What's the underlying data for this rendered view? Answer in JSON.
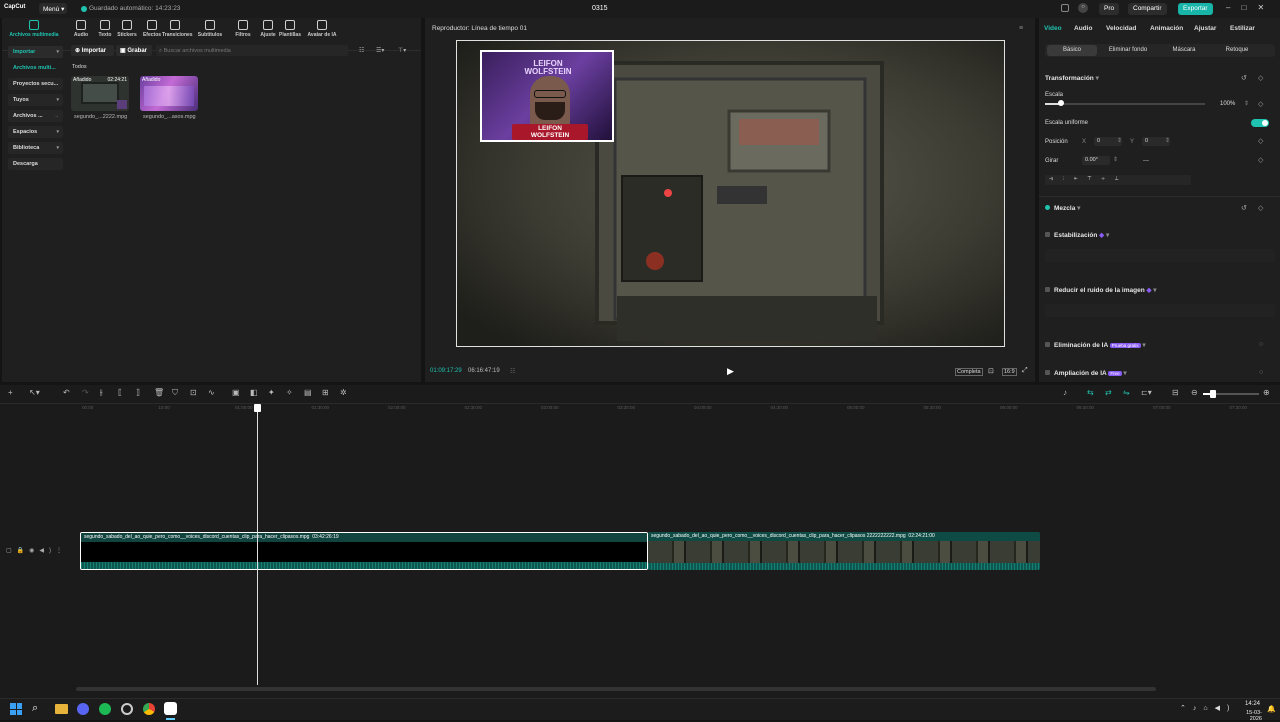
{
  "titlebar": {
    "app_logo": "CapCut",
    "menu_label": "Menú",
    "autosave_text": "Guardado automático: 14:23:23",
    "project_name": "0315",
    "pro_label": "Pro",
    "share_label": "Compartir",
    "export_label": "Exportar"
  },
  "toolbar": {
    "tools": [
      {
        "label": "Archivos multimedia",
        "icon": "media-icon"
      },
      {
        "label": "Audio",
        "icon": "audio-icon"
      },
      {
        "label": "Texto",
        "icon": "text-icon"
      },
      {
        "label": "Stickers",
        "icon": "sticker-icon"
      },
      {
        "label": "Efectos",
        "icon": "effects-icon"
      },
      {
        "label": "Transiciones",
        "icon": "transitions-icon"
      },
      {
        "label": "Subtítulos",
        "icon": "captions-icon"
      },
      {
        "label": "Filtros",
        "icon": "filters-icon"
      },
      {
        "label": "Ajuste",
        "icon": "adjust-icon"
      },
      {
        "label": "Plantillas",
        "icon": "templates-icon"
      },
      {
        "label": "Avatar de IA",
        "icon": "ai-avatar-icon"
      }
    ]
  },
  "media": {
    "sidebar": [
      {
        "label": "Importar",
        "state": "active-header"
      },
      {
        "label": "Archivos multi...",
        "state": "active"
      },
      {
        "label": "Proyectos secu...",
        "state": ""
      },
      {
        "label": "Tuyos",
        "state": ""
      },
      {
        "label": "Archivos ...",
        "state": ""
      },
      {
        "label": "Espacios",
        "state": ""
      },
      {
        "label": "Biblioteca",
        "state": ""
      },
      {
        "label": "Descarga",
        "state": ""
      }
    ],
    "import_label": "Importar",
    "record_label": "Grabar",
    "search_placeholder": "Buscar archivos multimedia",
    "filter_label": "Todos",
    "items": [
      {
        "badge": "Añadido",
        "duration": "02:24:21",
        "name": "segundo_...2222.mpg"
      },
      {
        "badge": "Añadido",
        "duration": "",
        "name": "segundo_...asos.mpg"
      }
    ]
  },
  "player": {
    "title": "Reproductor: Línea de tiempo 01",
    "current_time": "01:09:17:29",
    "total_time": "06:16:47:19",
    "ratio_label": "Completa",
    "aspect_label": "16:9",
    "overlay_name_line1": "LEIFON",
    "overlay_name_line2": "WOLFSTEIN"
  },
  "props": {
    "tabs": [
      "Video",
      "Audio",
      "Velocidad",
      "Animación",
      "Ajustar",
      "Estilizar"
    ],
    "subtabs": [
      "Básico",
      "Eliminar fondo",
      "Máscara",
      "Retoque"
    ],
    "transform_title": "Transformación",
    "scale_label": "Escala",
    "scale_value": "100%",
    "scale_level": 0.1,
    "uniform_scale_label": "Escala uniforme",
    "uniform_scale_on": true,
    "position_label": "Posición",
    "pos_x_label": "X",
    "pos_x": "0",
    "pos_y_label": "Y",
    "pos_y": "0",
    "rotate_label": "Girar",
    "rotate_value": "0.00°",
    "rotate_extra": "—",
    "blend_label": "Mezcla",
    "stabilize_label": "Estabilización",
    "denoise_label": "Reducir el ruido de la imagen",
    "ai_remove_label": "Eliminación de IA",
    "ai_remove_badge": "Prueba gratis",
    "ai_upscale_label": "Ampliación de IA",
    "ai_upscale_badge": "Free"
  },
  "timeline": {
    "ruler": [
      "00:00",
      "10:00",
      "01:00:00",
      "01:30:00",
      "02:00:00",
      "02:30:00",
      "03:00:00",
      "03:30:00",
      "04:00:00",
      "04:30:00",
      "05:00:00",
      "05:30:00",
      "06:00:00",
      "06:30:00",
      "07:00:00",
      "07:30:00"
    ],
    "clips": [
      {
        "name": "segundo_sabado_del_ao_quie_pero_como__voices_discord_cuentas_clip_para_hacer_clipasos.mpg",
        "duration": "03:42:26:19"
      },
      {
        "name": "segundo_sabado_del_ao_quie_pero_como__voices_discord_cuentas_clip_para_hacer_clipasos 2222222222.mpg",
        "duration": "02:24:21:00"
      }
    ]
  },
  "taskbar": {
    "time": "14:24",
    "date": "15-03-2026"
  },
  "colors": {
    "accent": "#1fc3b0",
    "export": "#18b4a8",
    "pro_badge": "#8a5cf6"
  }
}
